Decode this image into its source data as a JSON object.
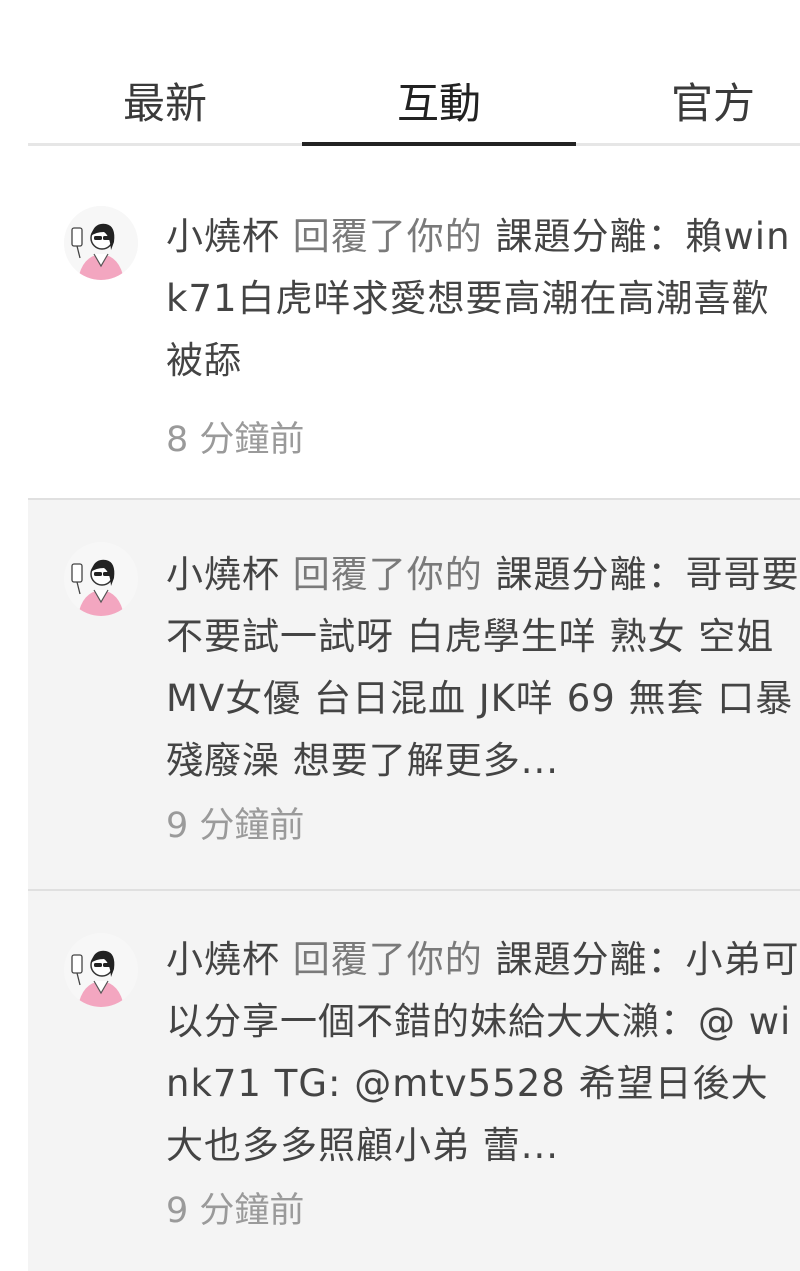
{
  "tabs": [
    {
      "label": "最新",
      "active": false
    },
    {
      "label": "互動",
      "active": true
    },
    {
      "label": "官方",
      "active": false
    }
  ],
  "notifications": [
    {
      "actor": "小燒杯",
      "verb": "回覆了你的",
      "post": "課題分離",
      "separator": "：",
      "content": "賴wink71白虎咩求愛想要高潮在高潮喜歡被舔",
      "time": "8 分鐘前",
      "avatar": "user-avatar-icon"
    },
    {
      "actor": "小燒杯",
      "verb": "回覆了你的",
      "post": "課題分離",
      "separator": "：",
      "content": "哥哥要不要試一試呀 白虎學生咩 熟女 空姐 MV女優 台日混血 JK咩 69 無套 口暴 殘廢澡 想要了解更多...",
      "time": "9 分鐘前",
      "avatar": "user-avatar-icon"
    },
    {
      "actor": "小燒杯",
      "verb": "回覆了你的",
      "post": "課題分離",
      "separator": "：",
      "content": "小弟可以分享一個不錯的妹給大大瀨：@ wink71 TG: @mtv5528 希望日後大大也多多照顧小弟 蕾...",
      "time": "9 分鐘前",
      "avatar": "user-avatar-icon"
    }
  ],
  "colors": {
    "active_tab_indicator": "#222222",
    "tab_divider": "#e6e6e6",
    "read_background": "#ffffff",
    "unread_background": "#f4f4f4",
    "time_text": "#9a9a9a",
    "avatar_accent": "#f3a6c0"
  }
}
